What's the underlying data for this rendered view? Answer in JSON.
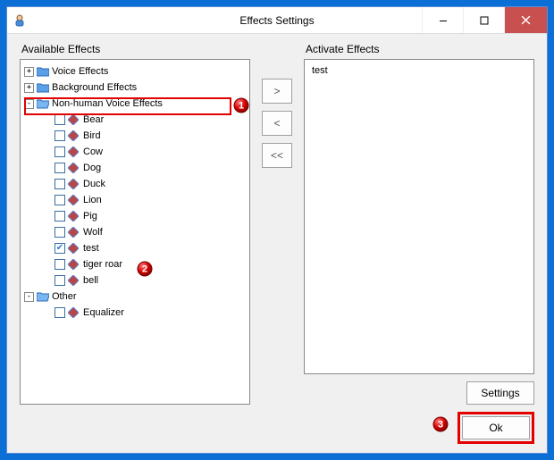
{
  "window": {
    "title": "Effects Settings"
  },
  "labels": {
    "available": "Available Effects",
    "activate": "Activate Effects"
  },
  "tree": {
    "cat0": {
      "label": "Voice Effects",
      "expanded": false
    },
    "cat1": {
      "label": "Background Effects",
      "expanded": false
    },
    "cat2": {
      "label": "Non-human Voice Effects",
      "expanded": true,
      "items": [
        "Bear",
        "Bird",
        "Cow",
        "Dog",
        "Duck",
        "Lion",
        "Pig",
        "Wolf",
        "test",
        "tiger roar",
        "bell"
      ],
      "checked": {
        "8": true
      }
    },
    "cat3": {
      "label": "Other",
      "expanded": true,
      "items": [
        "Equalizer"
      ]
    }
  },
  "activate_list": [
    "test"
  ],
  "mid": {
    "add": ">",
    "remove": "<",
    "remove_all": "<<"
  },
  "buttons": {
    "settings": "Settings",
    "ok": "Ok"
  },
  "callouts": {
    "one": "1",
    "two": "2",
    "three": "3"
  }
}
